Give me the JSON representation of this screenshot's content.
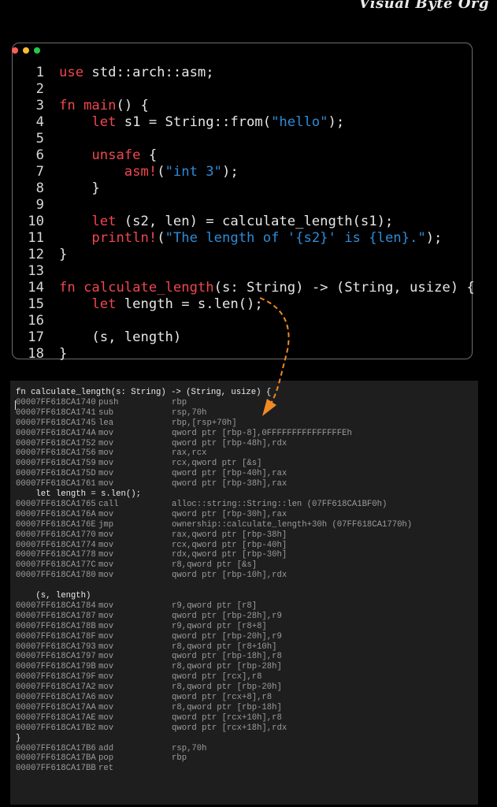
{
  "brand": {
    "text": "Visual Byte Org"
  },
  "code_window": {
    "dot_colors": [
      "#ff5f57",
      "#febc2e",
      "#28c840"
    ],
    "lines": [
      {
        "n": "1",
        "segs": [
          {
            "t": "use",
            "c": "kw"
          },
          {
            "t": " std::arch::asm;"
          }
        ]
      },
      {
        "n": "2",
        "segs": []
      },
      {
        "n": "3",
        "segs": [
          {
            "t": "fn",
            "c": "kw"
          },
          {
            "t": " "
          },
          {
            "t": "main",
            "c": "kw"
          },
          {
            "t": "() {"
          }
        ]
      },
      {
        "n": "4",
        "segs": [
          {
            "t": "    "
          },
          {
            "t": "let",
            "c": "kw"
          },
          {
            "t": " s1 = String::from("
          },
          {
            "t": "\"hello\"",
            "c": "str"
          },
          {
            "t": ");"
          }
        ]
      },
      {
        "n": "5",
        "segs": []
      },
      {
        "n": "6",
        "segs": [
          {
            "t": "    "
          },
          {
            "t": "unsafe",
            "c": "kw"
          },
          {
            "t": " {"
          }
        ]
      },
      {
        "n": "7",
        "segs": [
          {
            "t": "        "
          },
          {
            "t": "asm!",
            "c": "mac"
          },
          {
            "t": "("
          },
          {
            "t": "\"int 3\"",
            "c": "str"
          },
          {
            "t": ");"
          }
        ]
      },
      {
        "n": "8",
        "segs": [
          {
            "t": "    }"
          }
        ]
      },
      {
        "n": "9",
        "segs": []
      },
      {
        "n": "10",
        "segs": [
          {
            "t": "    "
          },
          {
            "t": "let",
            "c": "kw"
          },
          {
            "t": " (s2, len) = calculate_length(s1);"
          }
        ]
      },
      {
        "n": "11",
        "segs": [
          {
            "t": "    "
          },
          {
            "t": "println!",
            "c": "mac"
          },
          {
            "t": "("
          },
          {
            "t": "\"The length of '{s2}' is {len}.\"",
            "c": "str"
          },
          {
            "t": ");"
          }
        ]
      },
      {
        "n": "12",
        "segs": [
          {
            "t": "}"
          }
        ]
      },
      {
        "n": "13",
        "segs": []
      },
      {
        "n": "14",
        "segs": [
          {
            "t": "fn",
            "c": "kw"
          },
          {
            "t": " "
          },
          {
            "t": "calculate_length",
            "c": "kw"
          },
          {
            "t": "(s: String) -> (String, usize) {"
          }
        ]
      },
      {
        "n": "15",
        "segs": [
          {
            "t": "    "
          },
          {
            "t": "let",
            "c": "kw"
          },
          {
            "t": " length = s.len();"
          }
        ]
      },
      {
        "n": "16",
        "segs": []
      },
      {
        "n": "17",
        "segs": [
          {
            "t": "    (s, length)"
          }
        ]
      },
      {
        "n": "18",
        "segs": [
          {
            "t": "}"
          }
        ]
      }
    ]
  },
  "arrow_color": "#f08a24",
  "disassembly": [
    {
      "src": "fn calculate_length(s: String) -> (String, usize) {"
    },
    {
      "addr": "00007FF618CA1740",
      "mn": "push",
      "op": "rbp"
    },
    {
      "addr": "00007FF618CA1741",
      "mn": "sub",
      "op": "rsp,70h"
    },
    {
      "addr": "00007FF618CA1745",
      "mn": "lea",
      "op": "rbp,[rsp+70h]"
    },
    {
      "addr": "00007FF618CA174A",
      "mn": "mov",
      "op": "qword ptr [rbp-8],0FFFFFFFFFFFFFFFEh"
    },
    {
      "addr": "00007FF618CA1752",
      "mn": "mov",
      "op": "qword ptr [rbp-48h],rdx"
    },
    {
      "addr": "00007FF618CA1756",
      "mn": "mov",
      "op": "rax,rcx"
    },
    {
      "addr": "00007FF618CA1759",
      "mn": "mov",
      "op": "rcx,qword ptr [&s]"
    },
    {
      "addr": "00007FF618CA175D",
      "mn": "mov",
      "op": "qword ptr [rbp-40h],rax"
    },
    {
      "addr": "00007FF618CA1761",
      "mn": "mov",
      "op": "qword ptr [rbp-38h],rax"
    },
    {
      "src": "    let length = s.len();"
    },
    {
      "addr": "00007FF618CA1765",
      "mn": "call",
      "op": "alloc::string::String::len (07FF618CA1BF0h)"
    },
    {
      "addr": "00007FF618CA176A",
      "mn": "mov",
      "op": "qword ptr [rbp-30h],rax"
    },
    {
      "addr": "00007FF618CA176E",
      "mn": "jmp",
      "op": "ownership::calculate_length+30h (07FF618CA1770h)"
    },
    {
      "addr": "00007FF618CA1770",
      "mn": "mov",
      "op": "rax,qword ptr [rbp-38h]"
    },
    {
      "addr": "00007FF618CA1774",
      "mn": "mov",
      "op": "rcx,qword ptr [rbp-40h]"
    },
    {
      "addr": "00007FF618CA1778",
      "mn": "mov",
      "op": "rdx,qword ptr [rbp-30h]"
    },
    {
      "addr": "00007FF618CA177C",
      "mn": "mov",
      "op": "r8,qword ptr [&s]"
    },
    {
      "addr": "00007FF618CA1780",
      "mn": "mov",
      "op": "qword ptr [rbp-10h],rdx"
    },
    {
      "blank": true
    },
    {
      "src": "    (s, length)"
    },
    {
      "addr": "00007FF618CA1784",
      "mn": "mov",
      "op": "r9,qword ptr [r8]"
    },
    {
      "addr": "00007FF618CA1787",
      "mn": "mov",
      "op": "qword ptr [rbp-28h],r9"
    },
    {
      "addr": "00007FF618CA178B",
      "mn": "mov",
      "op": "r9,qword ptr [r8+8]"
    },
    {
      "addr": "00007FF618CA178F",
      "mn": "mov",
      "op": "qword ptr [rbp-20h],r9"
    },
    {
      "addr": "00007FF618CA1793",
      "mn": "mov",
      "op": "r8,qword ptr [r8+10h]"
    },
    {
      "addr": "00007FF618CA1797",
      "mn": "mov",
      "op": "qword ptr [rbp-18h],r8"
    },
    {
      "addr": "00007FF618CA179B",
      "mn": "mov",
      "op": "r8,qword ptr [rbp-28h]"
    },
    {
      "addr": "00007FF618CA179F",
      "mn": "mov",
      "op": "qword ptr [rcx],r8"
    },
    {
      "addr": "00007FF618CA17A2",
      "mn": "mov",
      "op": "r8,qword ptr [rbp-20h]"
    },
    {
      "addr": "00007FF618CA17A6",
      "mn": "mov",
      "op": "qword ptr [rcx+8],r8"
    },
    {
      "addr": "00007FF618CA17AA",
      "mn": "mov",
      "op": "r8,qword ptr [rbp-18h]"
    },
    {
      "addr": "00007FF618CA17AE",
      "mn": "mov",
      "op": "qword ptr [rcx+10h],r8"
    },
    {
      "addr": "00007FF618CA17B2",
      "mn": "mov",
      "op": "qword ptr [rcx+18h],rdx"
    },
    {
      "src": "}"
    },
    {
      "addr": "00007FF618CA17B6",
      "mn": "add",
      "op": "rsp,70h"
    },
    {
      "addr": "00007FF618CA17BA",
      "mn": "pop",
      "op": "rbp"
    },
    {
      "addr": "00007FF618CA17BB",
      "mn": "ret",
      "op": ""
    }
  ]
}
